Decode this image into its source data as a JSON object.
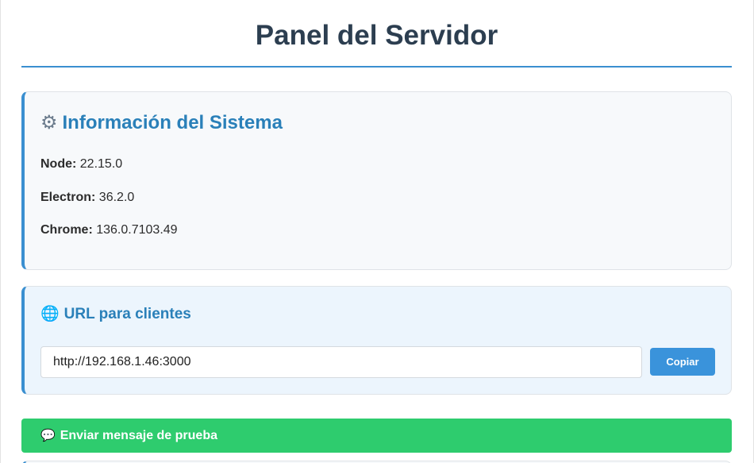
{
  "header": {
    "title": "Panel del Servidor"
  },
  "system_info": {
    "icon": "gear-icon",
    "title": "Información del Sistema",
    "rows": [
      {
        "label": "Node:",
        "value": "22.15.0"
      },
      {
        "label": "Electron:",
        "value": "36.2.0"
      },
      {
        "label": "Chrome:",
        "value": "136.0.7103.49"
      }
    ]
  },
  "client_url": {
    "icon": "globe-icon",
    "title": "URL para clientes",
    "url_value": "http://192.168.1.46:3000",
    "copy_label": "Copiar"
  },
  "test_message": {
    "icon": "speech-bubble-icon",
    "label": "Enviar mensaje de prueba"
  },
  "colors": {
    "accent": "#3a8fd0",
    "title_text": "#2c3e50",
    "section_title": "#2a80b9",
    "copy_button": "#3a93db",
    "send_button": "#2ecc6e"
  }
}
